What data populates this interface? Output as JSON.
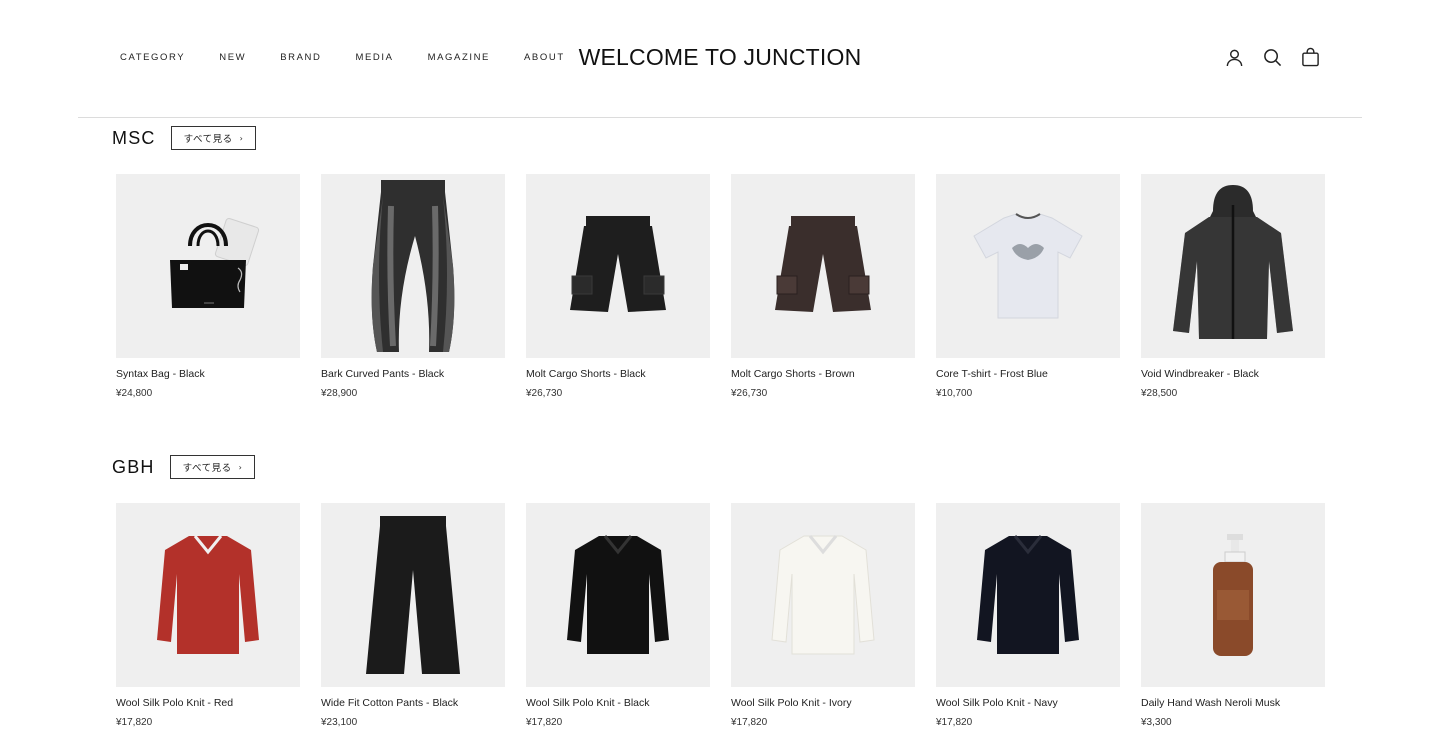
{
  "header": {
    "nav": [
      "CATEGORY",
      "NEW",
      "BRAND",
      "MEDIA",
      "MAGAZINE",
      "ABOUT"
    ],
    "logo": "WELCOME TO JUNCTION",
    "icons": [
      "account-icon",
      "search-icon",
      "bag-icon"
    ]
  },
  "sections": [
    {
      "title": "MSC",
      "see_all": "すべて見る",
      "products": [
        {
          "name": "Syntax Bag - Black",
          "price": "¥24,800",
          "image": "tote-bag",
          "color": "#111111"
        },
        {
          "name": "Bark Curved Pants - Black",
          "price": "¥28,900",
          "image": "pants",
          "color": "#2f2f2f"
        },
        {
          "name": "Molt Cargo Shorts - Black",
          "price": "¥26,730",
          "image": "shorts",
          "color": "#1e1e1e"
        },
        {
          "name": "Molt Cargo Shorts - Brown",
          "price": "¥26,730",
          "image": "shorts",
          "color": "#3a2e2c"
        },
        {
          "name": "Core T-shirt - Frost Blue",
          "price": "¥10,700",
          "image": "tshirt",
          "color": "#e6e8ef"
        },
        {
          "name": "Void Windbreaker - Black",
          "price": "¥28,500",
          "image": "jacket",
          "color": "#2b2b2b"
        }
      ]
    },
    {
      "title": "GBH",
      "see_all": "すべて見る",
      "products": [
        {
          "name": "Wool Silk Polo Knit - Red",
          "price": "¥17,820",
          "image": "polo",
          "color": "#b3312a"
        },
        {
          "name": "Wide Fit Cotton Pants - Black",
          "price": "¥23,100",
          "image": "wide-pants",
          "color": "#1b1b1b"
        },
        {
          "name": "Wool Silk Polo Knit - Black",
          "price": "¥17,820",
          "image": "polo",
          "color": "#111111"
        },
        {
          "name": "Wool Silk Polo Knit - Ivory",
          "price": "¥17,820",
          "image": "polo",
          "color": "#f3f1ea"
        },
        {
          "name": "Wool Silk Polo Knit - Navy",
          "price": "¥17,820",
          "image": "polo",
          "color": "#121521"
        },
        {
          "name": "Daily Hand Wash Neroli Musk",
          "price": "¥3,300",
          "image": "bottle",
          "color": "#8a4a2a"
        }
      ]
    }
  ]
}
